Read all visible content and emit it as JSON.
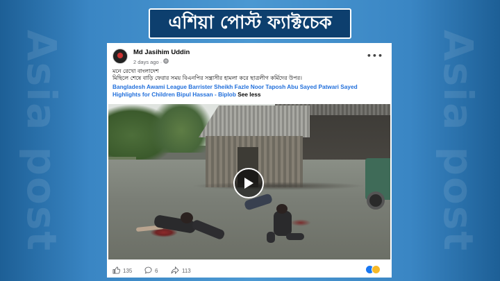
{
  "banner": {
    "title": "এশিয়া পোস্ট ফ্যাক্টচেক"
  },
  "watermark": {
    "text": "Asia post"
  },
  "post": {
    "author": "Md Jasihim Uddin",
    "timestamp": "2 days ago",
    "privacy_icon": "globe-icon",
    "more_icon": "more-options-icon",
    "line1": "মনে রেখো বাংলাদেশ",
    "line2": "মিছিলে শেষে বাড়ি ফেরার সময় বিএনপির সন্ত্রাসীর হামলা করে ছাত্রলীগ কর্মিদের উপর।",
    "tags": "Bangladesh Awami League Barrister Sheikh Fazle Noor Taposh Abu Sayed Patwari Sayed Highlights for Children Bipul Hassan - Biplob",
    "see_less": "See less"
  },
  "video": {
    "play_icon": "play-icon"
  },
  "engagement": {
    "likes": "135",
    "comments": "6",
    "shares": "113",
    "like_icon": "like-icon",
    "comment_icon": "comment-icon",
    "share_icon": "share-icon",
    "reaction_icons": [
      "like-reaction-icon",
      "sad-reaction-icon"
    ]
  },
  "colors": {
    "background": "#3a86c4",
    "banner": "#0d3f6e",
    "link": "#216fdb"
  }
}
